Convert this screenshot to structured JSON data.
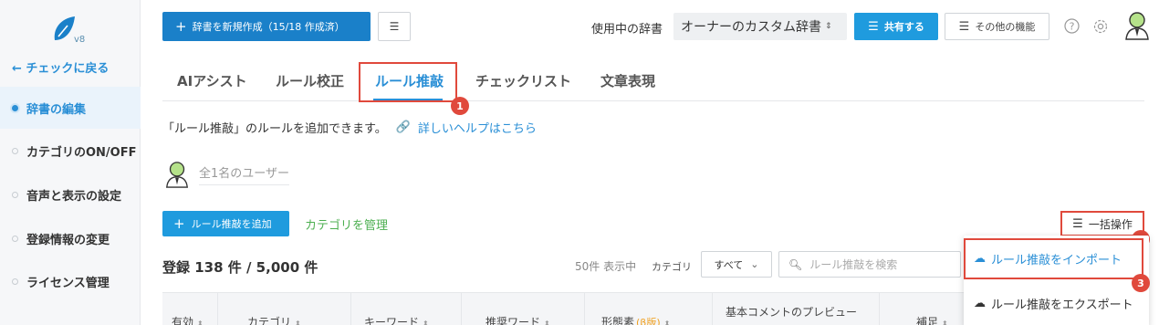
{
  "sidebar": {
    "version": "v8",
    "back": "← チェックに戻る",
    "items": [
      {
        "label": "辞書の編集"
      },
      {
        "label": "カテゴリのON/OFF"
      },
      {
        "label": "音声と表示の設定"
      },
      {
        "label": "登録情報の変更"
      },
      {
        "label": "ライセンス管理"
      }
    ]
  },
  "header": {
    "new_dict": "辞書を新規作成（15/18 作成済）",
    "dict_label": "使用中の辞書",
    "dict_value": "オーナーのカスタム辞書",
    "share": "共有する",
    "other": "その他の機能"
  },
  "tabs": [
    "AIアシスト",
    "ルール校正",
    "ルール推敲",
    "チェックリスト",
    "文章表現"
  ],
  "markers": [
    "1",
    "2",
    "3"
  ],
  "description": "「ルール推敲」のルールを追加できます。",
  "help_link": "詳しいヘルプはこちら",
  "users_text": "全1名のユーザー",
  "actions": {
    "add_rule": "ルール推敲を追加",
    "manage_category": "カテゴリを管理",
    "bulk": "一括操作"
  },
  "list": {
    "count": "登録 138 件 / 5,000 件",
    "showing": "50件 表示中",
    "category_label": "カテゴリ",
    "category_value": "すべて",
    "search_placeholder": "ルール推敲を検索"
  },
  "table_headers": {
    "enabled": "有効",
    "category": "カテゴリ",
    "keyword": "キーワード",
    "suggest": "推奨ワード",
    "morpheme": "形態素",
    "morpheme_tag": "(β版)",
    "comment": "基本コメントのプレビュー",
    "note": "補足"
  },
  "dropdown": {
    "import": "ルール推敲をインポート",
    "export": "ルール推敲をエクスポート"
  },
  "colors": {
    "primary": "#1a80c9",
    "accent": "#2a8fd6",
    "highlight": "#e0493c",
    "category_link": "#4caf50"
  }
}
